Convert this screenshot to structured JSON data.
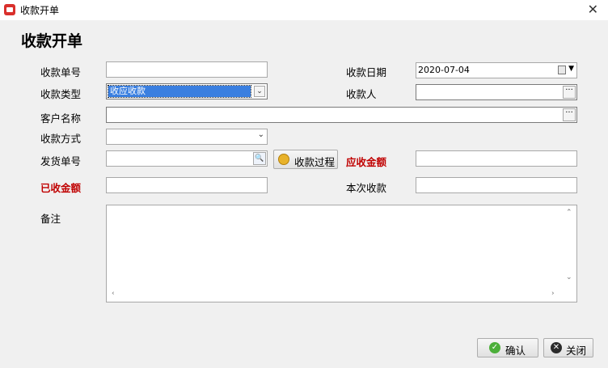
{
  "window": {
    "title": "收款开单",
    "close_glyph": "✕"
  },
  "heading": "收款开单",
  "form": {
    "receipt_no": {
      "label": "收款单号",
      "value": ""
    },
    "receipt_type": {
      "label": "收款类型",
      "value": "收应收款"
    },
    "customer": {
      "label": "客户名称",
      "value": ""
    },
    "method": {
      "label": "收款方式",
      "value": ""
    },
    "shipment_no": {
      "label": "发货单号",
      "value": ""
    },
    "process_button": "收款过程",
    "received_amount": {
      "label": "已收金额",
      "value": ""
    },
    "receipt_date": {
      "label": "收款日期",
      "value": "2020-07-04"
    },
    "receiver": {
      "label": "收款人",
      "value": ""
    },
    "receivable_amount": {
      "label": "应收金额",
      "value": ""
    },
    "current_amount": {
      "label": "本次收款",
      "value": ""
    },
    "remark": {
      "label": "备注",
      "value": ""
    }
  },
  "footer": {
    "confirm": "确认",
    "close": "关闭"
  },
  "colors": {
    "required_label": "#c00000",
    "selection": "#3a7fe0"
  },
  "icons": [
    "app-icon",
    "calendar-icon",
    "ellipsis-icon",
    "search-icon",
    "coin-icon",
    "check-icon",
    "close-icon"
  ]
}
